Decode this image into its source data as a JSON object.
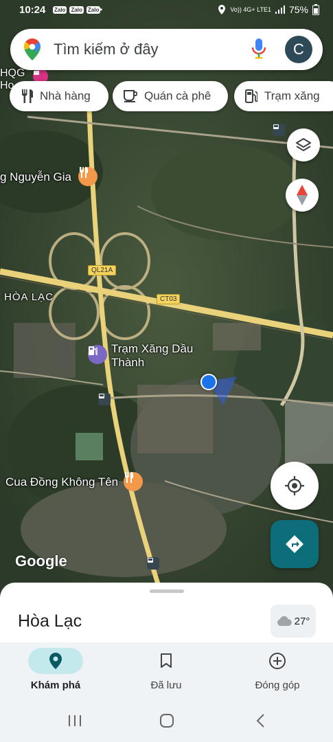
{
  "status_bar": {
    "time": "10:24",
    "app_badges": [
      "Zalo",
      "Zalo",
      "Zalo"
    ],
    "dot": "•",
    "network": "Vo)) 4G+ LTE1",
    "battery": "75%"
  },
  "search": {
    "placeholder": "Tìm kiếm ở đây",
    "avatar_letter": "C"
  },
  "chips": [
    {
      "label": "Nhà hàng",
      "icon": "restaurant-icon"
    },
    {
      "label": "Quán cà phê",
      "icon": "coffee-icon"
    },
    {
      "label": "Trạm xăng",
      "icon": "gas-station-icon"
    }
  ],
  "map": {
    "labels": {
      "top_left": "HQG\nHo",
      "nguyen_gia": "g Nguyễn Gia",
      "hoa_lac": "HÒA LẠC",
      "gas_station": "Trạm Xăng Dầu\nThành",
      "cua_dong": "Cua Đồng Không Tên"
    },
    "road_shields": [
      "QL21A",
      "CT03"
    ],
    "attribution": "Google"
  },
  "place_sheet": {
    "title": "Hòa Lạc",
    "temperature": "27°",
    "weather_icon": "cloud-icon"
  },
  "bottom_nav": [
    {
      "label": "Khám phá",
      "icon": "explore-pin-icon",
      "active": true
    },
    {
      "label": "Đã lưu",
      "icon": "bookmark-icon",
      "active": false
    },
    {
      "label": "Đóng góp",
      "icon": "add-circle-icon",
      "active": false
    }
  ],
  "colors": {
    "accent": "#0b6e79",
    "active_pill": "#c4e9ec",
    "location_dot": "#1a73e8",
    "poi_orange": "#f2994a",
    "poi_purple": "#7b68c4"
  }
}
